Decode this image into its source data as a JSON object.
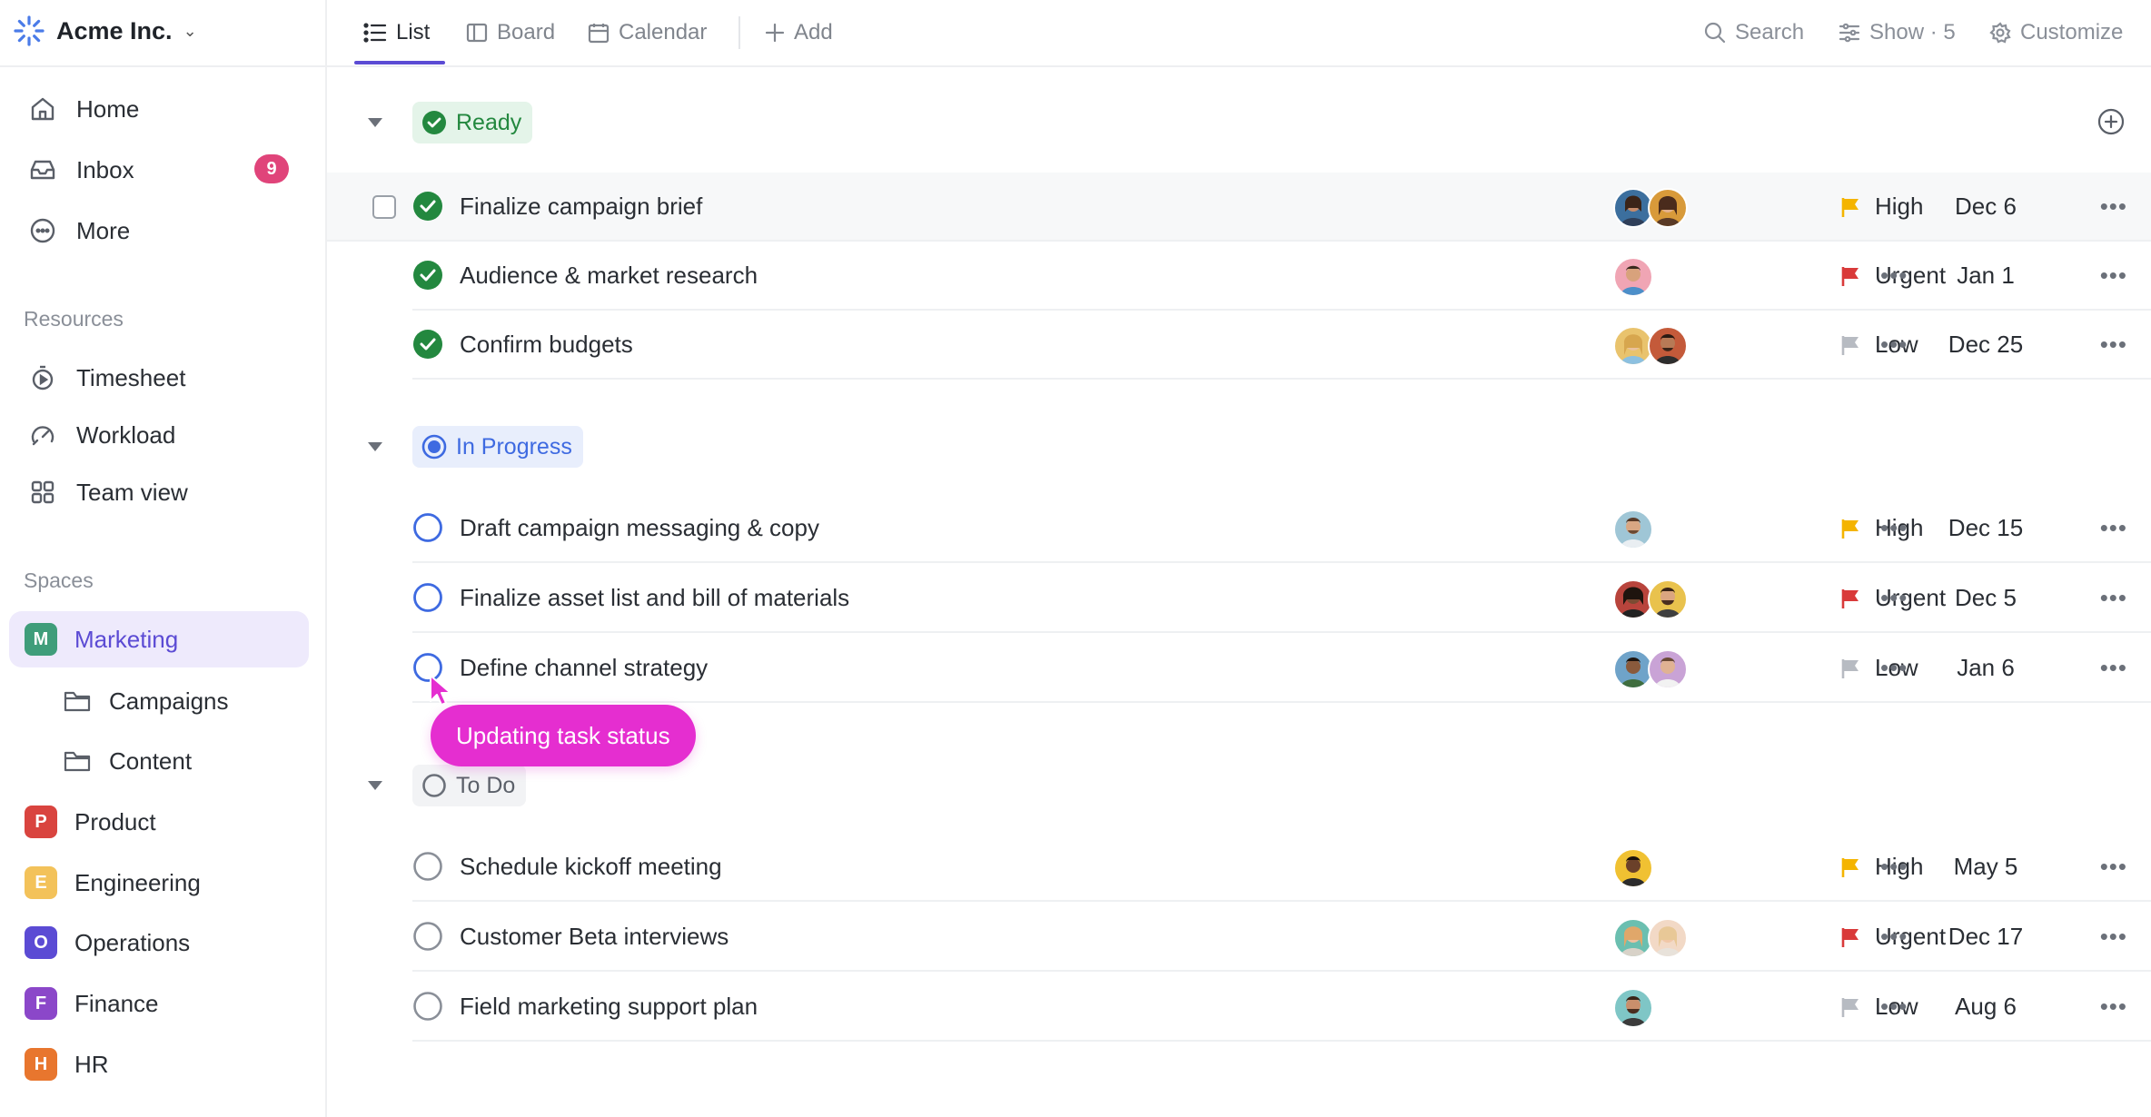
{
  "workspace": {
    "name": "Acme Inc."
  },
  "nav": [
    {
      "label": "Home",
      "icon": "home-icon"
    },
    {
      "label": "Inbox",
      "icon": "inbox-icon",
      "badge": "9"
    },
    {
      "label": "More",
      "icon": "more-icon"
    }
  ],
  "resources": {
    "heading": "Resources",
    "items": [
      {
        "label": "Timesheet",
        "icon": "timer-icon"
      },
      {
        "label": "Workload",
        "icon": "gauge-icon"
      },
      {
        "label": "Team view",
        "icon": "grid-icon"
      }
    ]
  },
  "spaces": {
    "heading": "Spaces",
    "items": [
      {
        "letter": "M",
        "label": "Marketing",
        "color": "#3f9d7a",
        "active": true
      },
      {
        "letter": "P",
        "label": "Product",
        "color": "#d9443f"
      },
      {
        "letter": "E",
        "label": "Engineering",
        "color": "#f3c25a"
      },
      {
        "letter": "O",
        "label": "Operations",
        "color": "#5b4bd4"
      },
      {
        "letter": "F",
        "label": "Finance",
        "color": "#8b47c9"
      },
      {
        "letter": "H",
        "label": "HR",
        "color": "#e8762e"
      }
    ],
    "folders": [
      {
        "label": "Campaigns"
      },
      {
        "label": "Content"
      }
    ]
  },
  "tabs": [
    {
      "label": "List",
      "active": true
    },
    {
      "label": "Board"
    },
    {
      "label": "Calendar"
    },
    {
      "label": "Add"
    }
  ],
  "toolbar": {
    "search": "Search",
    "show": "Show · 5",
    "customize": "Customize"
  },
  "groups": [
    {
      "status": "Ready",
      "tasks": [
        {
          "name": "Finalize campaign brief",
          "priority": "High",
          "date": "Dec 6"
        },
        {
          "name": "Audience & market research",
          "priority": "Urgent",
          "date": "Jan 1"
        },
        {
          "name": "Confirm budgets",
          "priority": "Low",
          "date": "Dec 25"
        }
      ]
    },
    {
      "status": "In Progress",
      "tasks": [
        {
          "name": "Draft campaign messaging & copy",
          "priority": "High",
          "date": "Dec 15"
        },
        {
          "name": "Finalize asset list and bill of materials",
          "priority": "Urgent",
          "date": "Dec 5"
        },
        {
          "name": "Define channel strategy",
          "priority": "Low",
          "date": "Jan 6"
        }
      ]
    },
    {
      "status": "To Do",
      "tasks": [
        {
          "name": "Schedule kickoff meeting",
          "priority": "High",
          "date": "May 5"
        },
        {
          "name": "Customer Beta interviews",
          "priority": "Urgent",
          "date": "Dec 17"
        },
        {
          "name": "Field marketing support plan",
          "priority": "Low",
          "date": "Aug 6"
        }
      ]
    }
  ],
  "tooltip": "Updating task status",
  "colors": {
    "accent": "#5b4bd4",
    "ready": "#23883f",
    "in_progress": "#3e6ae1",
    "high": "#f4b400",
    "urgent": "#d93a3a",
    "low": "#b7bbc2",
    "tooltip": "#e52ed0"
  }
}
